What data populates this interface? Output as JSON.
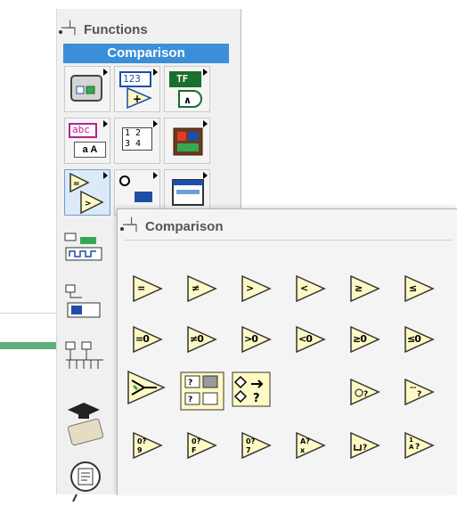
{
  "functions_palette": {
    "title": "Functions",
    "subheader": "Comparison",
    "tiles": [
      {
        "icon": "cluster-vi-icon"
      },
      {
        "icon": "numeric-palette-icon",
        "text": "123"
      },
      {
        "icon": "boolean-palette-icon",
        "text": "TF"
      },
      {
        "icon": "string-palette-icon",
        "text": "abc"
      },
      {
        "icon": "array-palette-icon",
        "text": "1 2 3 4"
      },
      {
        "icon": "cluster-class-icon"
      },
      {
        "icon": "comparison-palette-icon"
      },
      {
        "icon": "timing-palette-icon"
      },
      {
        "icon": "dialog-palette-icon"
      }
    ],
    "side_items": [
      "waveform-icon",
      "application-control-icon",
      "synchronization-icon",
      "graphics-sound-icon",
      "report-generation-icon"
    ]
  },
  "comparison_palette": {
    "title": "Comparison",
    "rows": [
      [
        "=",
        "≠",
        ">",
        "<",
        "≥",
        "≤"
      ],
      [
        "=0",
        "≠0",
        ">0",
        "<0",
        "≥0",
        "≤0"
      ],
      [
        "select-icon",
        "max-min-icon",
        "in-range-icon",
        "",
        "not-a-number-icon",
        "empty-string-icon"
      ],
      [
        "decimal-digit-icon",
        "hex-digit-icon",
        "octal-digit-icon",
        "printable-icon",
        "white-space-icon",
        "lexical-class-icon"
      ]
    ]
  },
  "colors": {
    "accent": "#3b8fd9",
    "vi_fill": "#fff9c4",
    "green_wire": "#5fb07a"
  }
}
